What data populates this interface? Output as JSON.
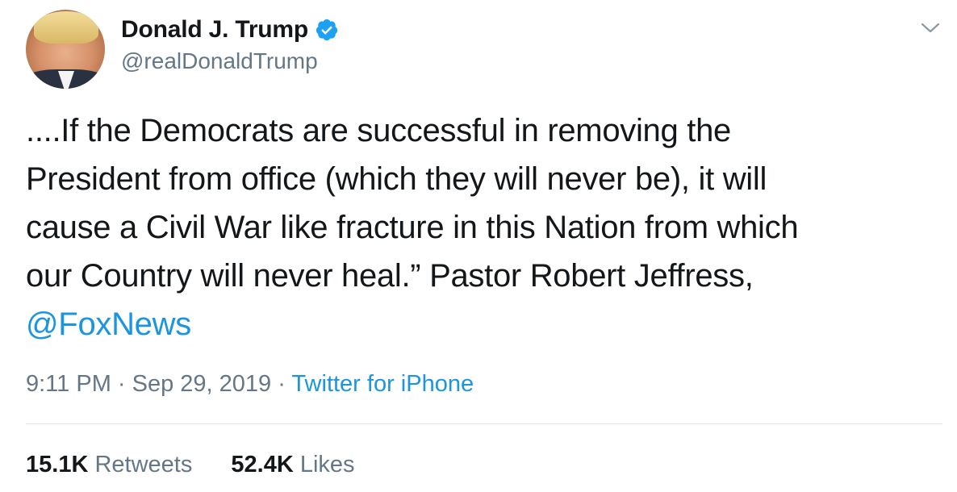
{
  "user": {
    "name": "Donald J. Trump",
    "handle": "@realDonaldTrump",
    "verified_icon": "verified-badge-icon"
  },
  "tweet": {
    "lines": [
      "....If the Democrats are successful in removing the",
      "President from office (which they will never be), it will",
      "cause a Civil War like fracture in this Nation from which",
      "our Country will never heal.” Pastor Robert Jeffress,"
    ],
    "mention": "@FoxNews"
  },
  "meta": {
    "time": "9:11 PM",
    "sep1": " · ",
    "date": "Sep 29, 2019",
    "sep2": " · ",
    "source": "Twitter for iPhone"
  },
  "stats": {
    "retweets_count": "15.1K",
    "retweets_label": "Retweets",
    "likes_count": "52.4K",
    "likes_label": "Likes"
  },
  "colors": {
    "link": "#1b95e0",
    "secondary_text": "#657786",
    "primary_text": "#14171a",
    "divider": "#e1e8ed"
  }
}
